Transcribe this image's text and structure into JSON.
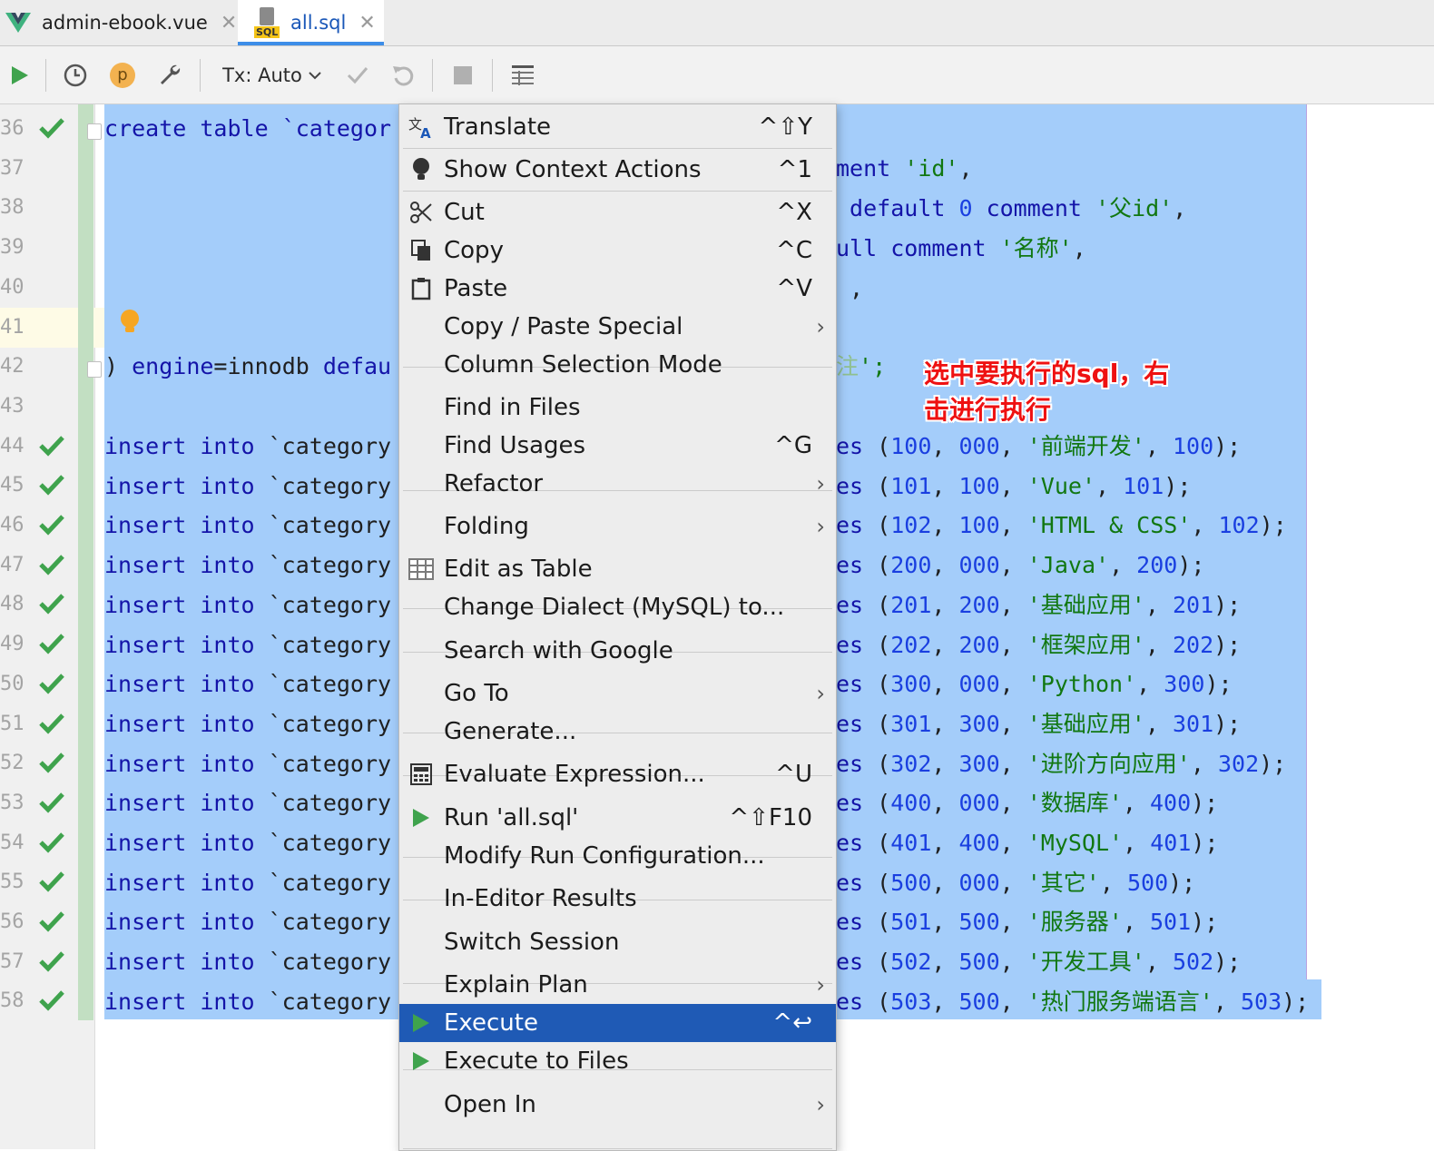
{
  "tabs": [
    {
      "label": "admin-ebook.vue",
      "icon": "vue-logo-icon",
      "active": false
    },
    {
      "label": "all.sql",
      "icon": "sql-file-icon",
      "active": true
    }
  ],
  "toolbar": {
    "run_icon": "play-icon",
    "history_icon": "clock-icon",
    "profile_badge": "p",
    "settings_icon": "wrench-icon",
    "tx_label": "Tx: Auto",
    "commit_icon": "check-icon",
    "rollback_icon": "undo-icon",
    "stop_icon": "stop-icon",
    "results_icon": "table-icon"
  },
  "editor": {
    "line_numbers": [
      "36",
      "37",
      "38",
      "39",
      "40",
      "41",
      "42",
      "43",
      "44",
      "45",
      "46",
      "47",
      "48",
      "49",
      "50",
      "51",
      "52",
      "53",
      "54",
      "55",
      "56",
      "57",
      "58"
    ],
    "left_fragments": {
      "l36": "create table `categor",
      "l42a": ") ",
      "l42b": "engine",
      "l42c": "=",
      "l42d": "innodb",
      "l42e": " defau",
      "insert_kw": "insert into",
      "insert_tbl": " `category"
    },
    "right_fragments": {
      "l37a": "ment ",
      "l37b": "'id'",
      "l37c": ",",
      "l38a": " default ",
      "l38b": "0",
      "l38c": " comment ",
      "l38d": "'父id'",
      "l38e": ",",
      "l39a": "ull comment ",
      "l39b": "'名称'",
      "l39c": ",",
      "l40": " ,",
      "l42a": "注",
      "l42b": "';"
    },
    "inserts": [
      {
        "a": "100",
        "b": "000",
        "name": "'前端开发'",
        "sort": "100"
      },
      {
        "a": "101",
        "b": "100",
        "name": "'Vue'",
        "sort": "101"
      },
      {
        "a": "102",
        "b": "100",
        "name": "'HTML & CSS'",
        "sort": "102"
      },
      {
        "a": "200",
        "b": "000",
        "name": "'Java'",
        "sort": "200"
      },
      {
        "a": "201",
        "b": "200",
        "name": "'基础应用'",
        "sort": "201"
      },
      {
        "a": "202",
        "b": "200",
        "name": "'框架应用'",
        "sort": "202"
      },
      {
        "a": "300",
        "b": "000",
        "name": "'Python'",
        "sort": "300"
      },
      {
        "a": "301",
        "b": "300",
        "name": "'基础应用'",
        "sort": "301"
      },
      {
        "a": "302",
        "b": "300",
        "name": "'进阶方向应用'",
        "sort": "302"
      },
      {
        "a": "400",
        "b": "000",
        "name": "'数据库'",
        "sort": "400"
      },
      {
        "a": "401",
        "b": "400",
        "name": "'MySQL'",
        "sort": "401"
      },
      {
        "a": "500",
        "b": "000",
        "name": "'其它'",
        "sort": "500"
      },
      {
        "a": "501",
        "b": "500",
        "name": "'服务器'",
        "sort": "501"
      },
      {
        "a": "502",
        "b": "500",
        "name": "'开发工具'",
        "sort": "502"
      },
      {
        "a": "503",
        "b": "500",
        "name": "'热门服务端语言'",
        "sort": "503"
      }
    ],
    "values_kw": "es",
    "annotation_line1": "选中要执行的sql，右",
    "annotation_line2": "击进行执行"
  },
  "context_menu": {
    "items": [
      {
        "label": "Translate",
        "shortcut": "^⇧Y",
        "icon": "translate-icon"
      },
      {
        "label": "Show Context Actions",
        "shortcut": "^1",
        "icon": "lightbulb-icon"
      },
      {
        "label": "Cut",
        "shortcut": "^X",
        "icon": "scissors-icon"
      },
      {
        "label": "Copy",
        "shortcut": "^C",
        "icon": "copy-icon"
      },
      {
        "label": "Paste",
        "shortcut": "^V",
        "icon": "clipboard-icon"
      },
      {
        "label": "Copy / Paste Special",
        "shortcut": "",
        "submenu": true
      },
      {
        "label": "Column Selection Mode",
        "shortcut": ""
      },
      {
        "label": "Find in Files",
        "shortcut": ""
      },
      {
        "label": "Find Usages",
        "shortcut": "^G"
      },
      {
        "label": "Refactor",
        "shortcut": "",
        "submenu": true
      },
      {
        "label": "Folding",
        "shortcut": "",
        "submenu": true
      },
      {
        "label": "Edit as Table",
        "shortcut": "",
        "icon": "table-icon"
      },
      {
        "label": "Change Dialect (MySQL) to...",
        "shortcut": ""
      },
      {
        "label": "Search with Google",
        "shortcut": ""
      },
      {
        "label": "Go To",
        "shortcut": "",
        "submenu": true
      },
      {
        "label": "Generate...",
        "shortcut": ""
      },
      {
        "label": "Evaluate Expression...",
        "shortcut": "^U",
        "icon": "calculator-icon"
      },
      {
        "label": "Run 'all.sql'",
        "shortcut": "^⇧F10",
        "icon": "play-icon"
      },
      {
        "label": "Modify Run Configuration...",
        "shortcut": ""
      },
      {
        "label": "In-Editor Results",
        "shortcut": ""
      },
      {
        "label": "Switch Session",
        "shortcut": ""
      },
      {
        "label": "Explain Plan",
        "shortcut": "",
        "submenu": true
      },
      {
        "label": "Execute",
        "shortcut": "^↩",
        "icon": "play-icon",
        "highlighted": true
      },
      {
        "label": "Execute to Files",
        "shortcut": "",
        "icon": "play-icon"
      },
      {
        "label": "Open In",
        "shortcut": "",
        "submenu": true
      }
    ],
    "submenu_arrow": "›",
    "highlight_color": "#1f5ab5"
  }
}
